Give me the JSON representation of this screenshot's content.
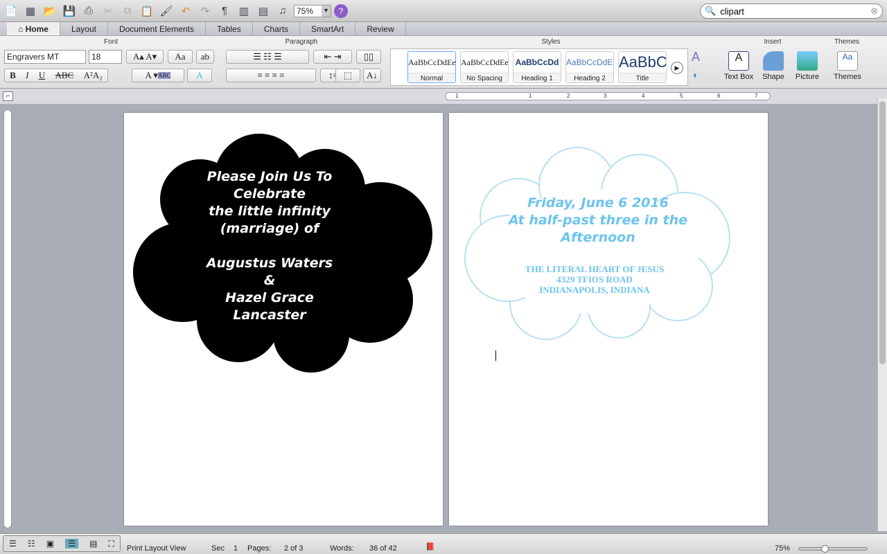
{
  "toolbar": {
    "icons": [
      "new-document-icon",
      "templates-icon",
      "open-icon",
      "save-icon",
      "print-icon",
      "cut-icon",
      "copy-icon",
      "paste-icon",
      "format-painter-icon",
      "undo-icon",
      "redo-icon",
      "pilcrow-icon",
      "sidebar-icon",
      "gallery-icon",
      "media-browser-icon",
      "help-icon"
    ],
    "zoom": "75%"
  },
  "search": {
    "value": "clipart"
  },
  "tabs": [
    "Home",
    "Layout",
    "Document Elements",
    "Tables",
    "Charts",
    "SmartArt",
    "Review"
  ],
  "ribbon": {
    "font": {
      "title": "Font",
      "family": "Engravers MT",
      "size": "18"
    },
    "paragraph": {
      "title": "Paragraph"
    },
    "styles": {
      "title": "Styles",
      "items": [
        {
          "preview": "AaBbCcDdEe",
          "label": "Normal"
        },
        {
          "preview": "AaBbCcDdEe",
          "label": "No Spacing"
        },
        {
          "preview": "AaBbCcDd",
          "label": "Heading 1"
        },
        {
          "preview": "AaBbCcDdEe",
          "label": "Heading 2"
        },
        {
          "preview": "AaBbC",
          "label": "Title"
        }
      ]
    },
    "insert": {
      "title": "Insert",
      "items": [
        "Text Box",
        "Shape",
        "Picture"
      ]
    },
    "themes": {
      "title": "Themes",
      "label": "Themes"
    }
  },
  "ruler": {
    "marks": [
      "1",
      "1",
      "2",
      "3",
      "4",
      "5",
      "6",
      "7"
    ]
  },
  "page1": {
    "lines": [
      "Please Join Us To",
      "Celebrate",
      "the little infinity",
      "(marriage) of",
      "",
      "Augustus Waters",
      "&",
      "Hazel Grace",
      "Lancaster"
    ]
  },
  "page2": {
    "lines1": [
      "Friday, June 6 2016",
      "At half-past three in the",
      "Afternoon"
    ],
    "lines2": [
      "THE LITERAL HEART OF JESUS",
      "4329 TFIOS ROAD",
      "INDIANAPOLIS, INDIANA"
    ],
    "accent": "#6cc4ee"
  },
  "status": {
    "view": "Print Layout View",
    "sec_label": "Sec",
    "sec": "1",
    "pages_label": "Pages:",
    "pages": "2 of 3",
    "words_label": "Words:",
    "words": "36 of 42",
    "zoom": "75%"
  }
}
